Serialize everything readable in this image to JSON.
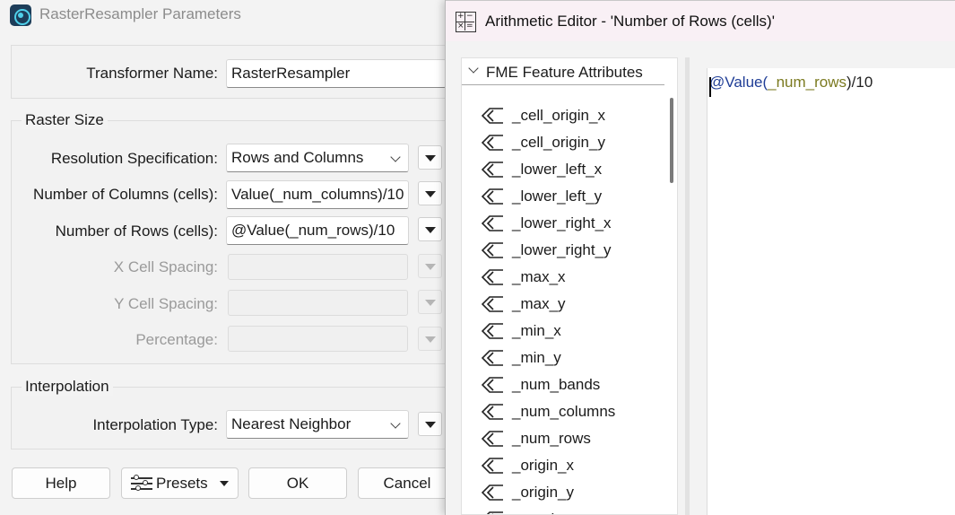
{
  "params_dialog": {
    "title": "RasterResampler Parameters",
    "transformer_name_label": "Transformer Name:",
    "transformer_name_value": "RasterResampler",
    "raster_size": {
      "group_title": "Raster Size",
      "resolution_label": "Resolution Specification:",
      "resolution_value": "Rows and Columns",
      "columns_label": "Number of Columns (cells):",
      "columns_value": "Value(_num_columns)/10",
      "rows_label": "Number of Rows (cells):",
      "rows_value": "@Value(_num_rows)/10",
      "x_spacing_label": "X Cell Spacing:",
      "y_spacing_label": "Y Cell Spacing:",
      "percentage_label": "Percentage:"
    },
    "interpolation": {
      "group_title": "Interpolation",
      "type_label": "Interpolation Type:",
      "type_value": "Nearest Neighbor"
    },
    "buttons": {
      "help": "Help",
      "presets": "Presets",
      "ok": "OK",
      "cancel": "Cancel"
    }
  },
  "editor": {
    "title": "Arithmetic Editor - 'Number of Rows (cells)'",
    "tree_header": "FME Feature Attributes",
    "attributes": [
      "_cell_origin_x",
      "_cell_origin_y",
      "_lower_left_x",
      "_lower_left_y",
      "_lower_right_x",
      "_lower_right_y",
      "_max_x",
      "_max_y",
      "_min_x",
      "_min_y",
      "_num_bands",
      "_num_columns",
      "_num_rows",
      "_origin_x",
      "_origin_y",
      "_rotation_x"
    ],
    "expression": {
      "func": "@Value(",
      "arg": "_num_rows",
      "rest": ")/10"
    }
  }
}
